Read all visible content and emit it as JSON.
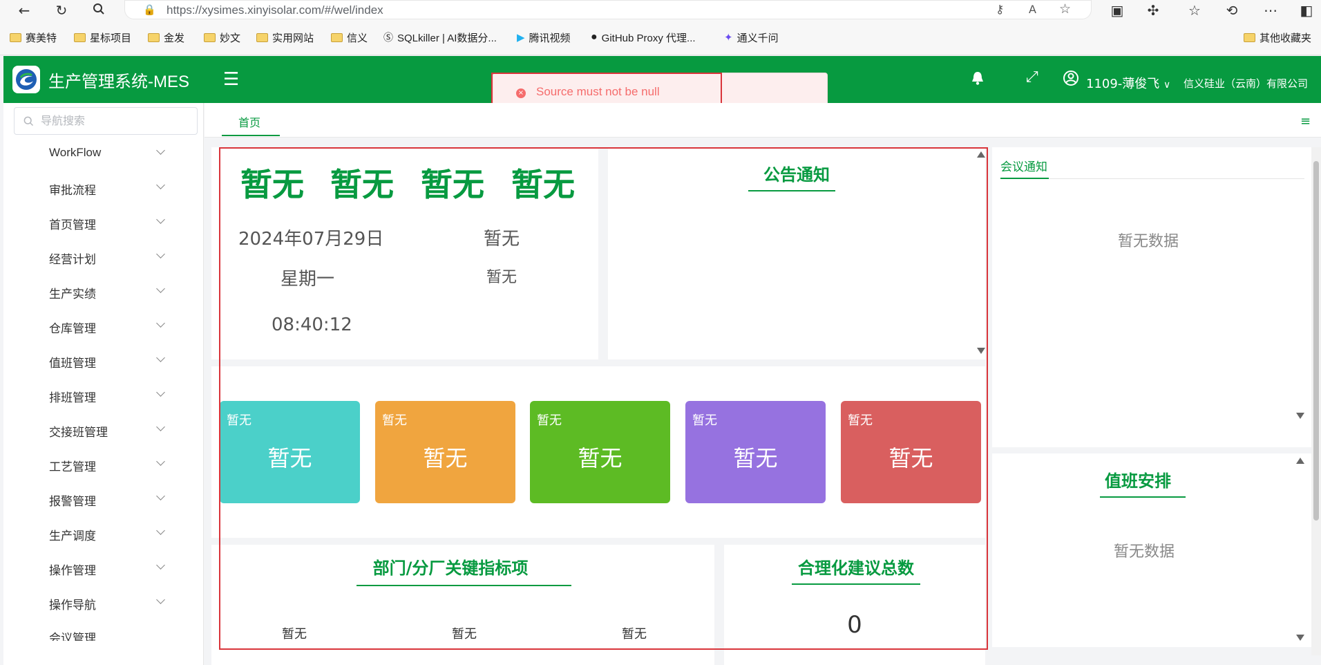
{
  "browser": {
    "url": "https://xysimes.xinyisolar.com/#/wel/index",
    "bookmarks": [
      "赛美特",
      "星标项目",
      "金发",
      "妙文",
      "实用网站",
      "信义",
      "SQLkiller | AI数据分...",
      "腾讯视频",
      "GitHub Proxy 代理...",
      "通义千问"
    ],
    "other_bookmarks": "其他收藏夹"
  },
  "header": {
    "title": "生产管理系统-MES",
    "error_message": "Source must not be null",
    "user": "1109-薄俊飞",
    "company": "信义硅业（云南）有限公司"
  },
  "sidebar": {
    "search_placeholder": "导航搜索",
    "items": [
      "WorkFlow",
      "审批流程",
      "首页管理",
      "经营计划",
      "生产实绩",
      "仓库管理",
      "值班管理",
      "排班管理",
      "交接班管理",
      "工艺管理",
      "报警管理",
      "生产调度",
      "操作管理",
      "操作导航",
      "会议管理"
    ]
  },
  "tabs": {
    "home": "首页"
  },
  "dashboard": {
    "top_values": [
      "暂无",
      "暂无",
      "暂无",
      "暂无"
    ],
    "date": "2024年07月29日",
    "weekday": "星期一",
    "time": "08:40:12",
    "side_value_1": "暂无",
    "side_value_2": "暂无",
    "notice_title": "公告通知",
    "cards": [
      {
        "small": "暂无",
        "big": "暂无",
        "color": "#4bd0c9"
      },
      {
        "small": "暂无",
        "big": "暂无",
        "color": "#f0a53f"
      },
      {
        "small": "暂无",
        "big": "暂无",
        "color": "#5dbb24"
      },
      {
        "small": "暂无",
        "big": "暂无",
        "color": "#9672e0"
      },
      {
        "small": "暂无",
        "big": "暂无",
        "color": "#d95f5f"
      }
    ],
    "kpi_title": "部门/分厂关键指标项",
    "kpi_values": [
      "暂无",
      "暂无",
      "暂无"
    ],
    "suggest_title": "合理化建议总数",
    "suggest_count": "0"
  },
  "right_panel": {
    "meeting_tab": "会议通知",
    "meeting_empty": "暂无数据",
    "duty_title": "值班安排",
    "duty_empty": "暂无数据"
  },
  "colors": {
    "brand": "#079a40",
    "error": "#f56c6c",
    "highlight_border": "#d9343a"
  }
}
